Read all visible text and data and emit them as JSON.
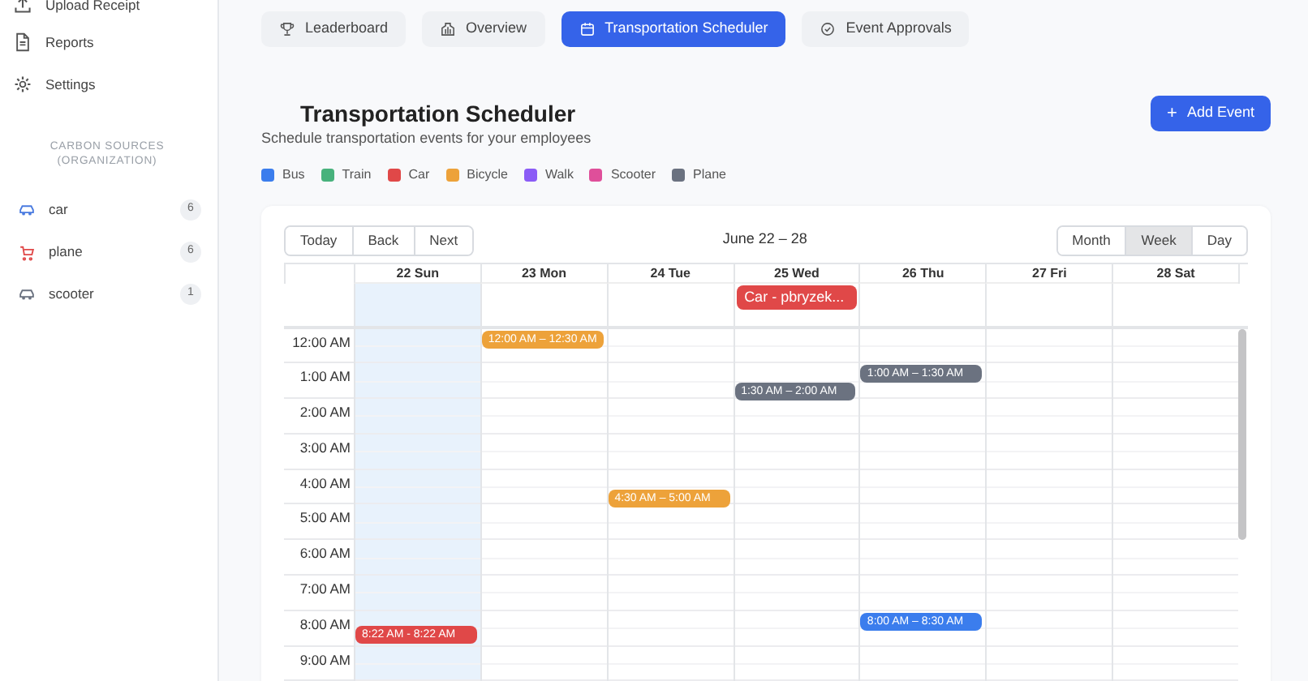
{
  "sidebar": {
    "nav": [
      {
        "label": "Upload Receipt"
      },
      {
        "label": "Reports"
      },
      {
        "label": "Settings"
      }
    ],
    "section_title": "CARBON SOURCES (ORGANIZATION)",
    "sources": [
      {
        "label": "car",
        "count": "6",
        "color": "#4a7be0"
      },
      {
        "label": "plane",
        "count": "6",
        "color": "#e04848"
      },
      {
        "label": "scooter",
        "count": "1",
        "color": "#6b7280"
      }
    ]
  },
  "tabs": [
    {
      "label": "Leaderboard",
      "selected": false
    },
    {
      "label": "Overview",
      "selected": false
    },
    {
      "label": "Transportation Scheduler",
      "selected": true
    },
    {
      "label": "Event Approvals",
      "selected": false
    }
  ],
  "header": {
    "title": "Transportation Scheduler",
    "subtitle": "Schedule transportation events for your employees",
    "add_button": "Add Event",
    "add_icon": "+"
  },
  "legend": [
    {
      "label": "Bus",
      "color": "#3b7ded"
    },
    {
      "label": "Train",
      "color": "#48b27c"
    },
    {
      "label": "Car",
      "color": "#e04848"
    },
    {
      "label": "Bicycle",
      "color": "#eda23a"
    },
    {
      "label": "Walk",
      "color": "#8b5cf6"
    },
    {
      "label": "Scooter",
      "color": "#df4f9a"
    },
    {
      "label": "Plane",
      "color": "#6b7280"
    }
  ],
  "calendar": {
    "nav_buttons": [
      "Today",
      "Back",
      "Next"
    ],
    "range": "June 22 – 28",
    "views": [
      {
        "label": "Month",
        "selected": false
      },
      {
        "label": "Week",
        "selected": true
      },
      {
        "label": "Day",
        "selected": false
      }
    ],
    "days": [
      {
        "label": "22 Sun",
        "today": true,
        "events": [
          {
            "label": "8:22 AM - 8:22 AM",
            "color": "#e04848"
          }
        ]
      },
      {
        "label": "23 Mon",
        "today": false,
        "events": [
          {
            "label": "12:00 AM – 12:30 AM",
            "color": "#eda23a"
          }
        ]
      },
      {
        "label": "24 Tue",
        "today": false,
        "events": [
          {
            "label": "4:30 AM – 5:00 AM",
            "color": "#eda23a"
          }
        ]
      },
      {
        "label": "25 Wed",
        "today": false,
        "all_day": [
          {
            "label": "Car - pbryzek...",
            "color": "#e04848"
          }
        ],
        "events": [
          {
            "label": "1:30 AM – 2:00 AM",
            "color": "#6b7280"
          }
        ]
      },
      {
        "label": "26 Thu",
        "today": false,
        "events": [
          {
            "label": "1:00 AM – 1:30 AM",
            "color": "#6b7280"
          },
          {
            "label": "8:00 AM – 8:30 AM",
            "color": "#3b7ded"
          }
        ]
      },
      {
        "label": "27 Fri",
        "today": false
      },
      {
        "label": "28 Sat",
        "today": false
      }
    ],
    "hours": [
      "12:00 AM",
      "1:00 AM",
      "2:00 AM",
      "3:00 AM",
      "4:00 AM",
      "5:00 AM",
      "6:00 AM",
      "7:00 AM",
      "8:00 AM",
      "9:00 AM"
    ]
  }
}
